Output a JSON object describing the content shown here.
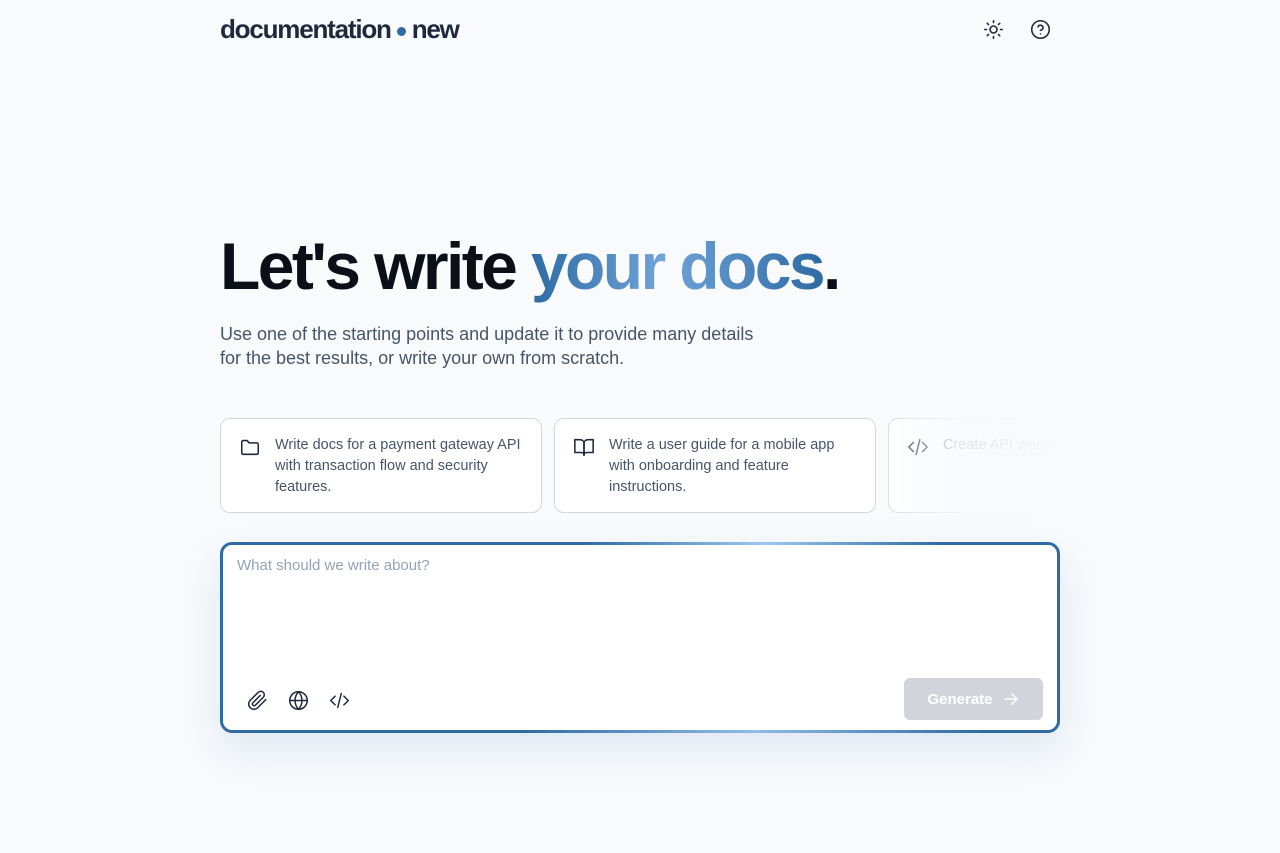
{
  "header": {
    "brand_left": "documentation",
    "brand_right": "new",
    "icons": [
      "sun-icon",
      "help-circle-icon"
    ]
  },
  "hero": {
    "title_start": "Let's write",
    "title_accent": "your docs",
    "title_end": ".",
    "subtitle_line1": "Use one of the starting points and update it to provide many details",
    "subtitle_line2": "for the best results, or write your own from scratch."
  },
  "starters": [
    {
      "icon": "folder-icon",
      "text": "Write docs for a payment gateway API with transaction flow and security features."
    },
    {
      "icon": "book-open-icon",
      "text": "Write a user guide for a mobile app with onboarding and feature instructions."
    },
    {
      "icon": "code-icon",
      "text": "Create API weather da authenticati"
    }
  ],
  "prompt": {
    "placeholder": "What should we write about?",
    "value": "",
    "tools": [
      "paperclip-icon",
      "globe-icon",
      "code-icon"
    ],
    "generate_label": "Generate"
  },
  "colors": {
    "accent": "#2f6aa3",
    "accent_light": "#6fa4d8",
    "background": "#f8fafc",
    "generate_disabled": "#d1d5db"
  }
}
